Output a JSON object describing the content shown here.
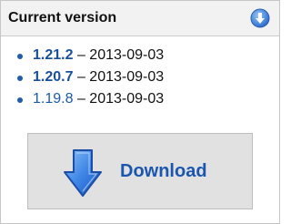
{
  "header": {
    "title": "Current version",
    "icon": "circle-arrow-down-icon"
  },
  "versions": [
    {
      "version": "1.21.2",
      "separator": "–",
      "date": "2013-09-03"
    },
    {
      "version": "1.20.7",
      "separator": "–",
      "date": "2013-09-03"
    },
    {
      "version": "1.19.8",
      "separator": "–",
      "date": "2013-09-03"
    }
  ],
  "download": {
    "label": "Download",
    "icon": "download-arrow-icon"
  },
  "colors": {
    "accent": "#1a56b0",
    "link": "#1b5aa8",
    "header_bg": "#f2f2f2",
    "button_bg": "#e1e1e1"
  }
}
